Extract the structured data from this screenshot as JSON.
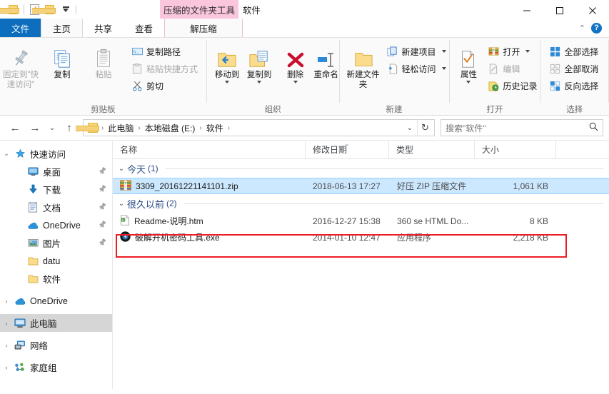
{
  "window": {
    "title": "软件",
    "contextual_tab_header": "压缩的文件夹工具",
    "minimize": "–",
    "maximize": "□",
    "close": "✕",
    "collapse_ribbon": "⌃",
    "help": "?"
  },
  "quick_access_toolbar": {
    "items": [
      {
        "name": "folder-icon",
        "label": ""
      },
      {
        "name": "properties-icon",
        "label": ""
      },
      {
        "name": "new-folder-icon",
        "label": ""
      },
      {
        "name": "customize-dropdown",
        "label": ""
      }
    ]
  },
  "tabs": [
    {
      "id": "file",
      "label": "文件"
    },
    {
      "id": "home",
      "label": "主页"
    },
    {
      "id": "share",
      "label": "共享"
    },
    {
      "id": "view",
      "label": "查看"
    },
    {
      "id": "extract",
      "label": "解压缩"
    }
  ],
  "ribbon": {
    "groups": [
      {
        "label": "剪贴板",
        "big_buttons": [
          {
            "label": "固定到\"快速访问\"",
            "disabled": true,
            "icon": "pin-icon"
          },
          {
            "label": "复制",
            "disabled": false,
            "icon": "copy-icon"
          },
          {
            "label": "粘贴",
            "disabled": true,
            "icon": "paste-icon"
          }
        ],
        "small_buttons": [
          {
            "label": "复制路径",
            "disabled": false,
            "icon": "copy-path-icon"
          },
          {
            "label": "粘贴快捷方式",
            "disabled": true,
            "icon": "paste-shortcut-icon"
          },
          {
            "label": "剪切",
            "disabled": false,
            "icon": "scissors-icon"
          }
        ]
      },
      {
        "label": "组织",
        "buttons": [
          {
            "label": "移动到",
            "icon": "move-to-icon",
            "has_dropdown": true
          },
          {
            "label": "复制到",
            "icon": "copy-to-icon",
            "has_dropdown": true
          },
          {
            "label": "删除",
            "icon": "delete-icon",
            "has_dropdown": true
          },
          {
            "label": "重命名",
            "icon": "rename-icon",
            "has_dropdown": false
          }
        ]
      },
      {
        "label": "新建",
        "big_buttons": [
          {
            "label": "新建文件夹",
            "icon": "new-folder-icon"
          }
        ],
        "small_buttons": [
          {
            "label": "新建项目",
            "icon": "new-item-icon",
            "has_dropdown": true
          },
          {
            "label": "轻松访问",
            "icon": "easy-access-icon",
            "has_dropdown": true
          }
        ]
      },
      {
        "label": "打开",
        "big_buttons": [
          {
            "label": "属性",
            "icon": "properties-icon",
            "has_dropdown": true
          }
        ],
        "small_buttons": [
          {
            "label": "打开",
            "icon": "open-archive-icon",
            "has_dropdown": true,
            "disabled": false
          },
          {
            "label": "编辑",
            "icon": "edit-icon",
            "disabled": true
          },
          {
            "label": "历史记录",
            "icon": "history-icon",
            "disabled": false
          }
        ]
      },
      {
        "label": "选择",
        "small_buttons": [
          {
            "label": "全部选择",
            "icon": "select-all-icon"
          },
          {
            "label": "全部取消",
            "icon": "select-none-icon"
          },
          {
            "label": "反向选择",
            "icon": "invert-selection-icon"
          }
        ]
      }
    ]
  },
  "address_bar": {
    "back": "←",
    "forward": "→",
    "recent": "⌄",
    "up": "↑",
    "breadcrumbs": [
      "此电脑",
      "本地磁盘 (E:)",
      "软件"
    ],
    "separator": "›",
    "dropdown": "⌄",
    "refresh": "↻"
  },
  "search": {
    "placeholder": "搜索\"软件\"",
    "icon": "search-icon"
  },
  "nav_pane": {
    "items": [
      {
        "label": "快速访问",
        "icon": "star-icon",
        "chevron": "⌄",
        "indent": 0,
        "pinned": false,
        "selected": false
      },
      {
        "label": "桌面",
        "icon": "desktop-icon",
        "chevron": "",
        "indent": 1,
        "pinned": true,
        "selected": false
      },
      {
        "label": "下载",
        "icon": "download-icon",
        "chevron": "",
        "indent": 1,
        "pinned": true,
        "selected": false
      },
      {
        "label": "文档",
        "icon": "documents-icon",
        "chevron": "",
        "indent": 1,
        "pinned": true,
        "selected": false
      },
      {
        "label": "OneDrive",
        "icon": "onedrive-icon",
        "chevron": "",
        "indent": 1,
        "pinned": true,
        "selected": false
      },
      {
        "label": "图片",
        "icon": "pictures-icon",
        "chevron": "",
        "indent": 1,
        "pinned": true,
        "selected": false
      },
      {
        "label": "datu",
        "icon": "folder-icon",
        "chevron": "",
        "indent": 1,
        "pinned": false,
        "selected": false
      },
      {
        "label": "软件",
        "icon": "folder-icon",
        "chevron": "",
        "indent": 1,
        "pinned": false,
        "selected": false
      },
      {
        "label": "OneDrive",
        "icon": "onedrive-icon",
        "chevron": "›",
        "indent": 0,
        "pinned": false,
        "selected": false
      },
      {
        "label": "此电脑",
        "icon": "thispc-icon",
        "chevron": "›",
        "indent": 0,
        "pinned": false,
        "selected": true
      },
      {
        "label": "网络",
        "icon": "network-icon",
        "chevron": "›",
        "indent": 0,
        "pinned": false,
        "selected": false
      },
      {
        "label": "家庭组",
        "icon": "homegroup-icon",
        "chevron": "›",
        "indent": 0,
        "pinned": false,
        "selected": false
      }
    ]
  },
  "file_list": {
    "columns": [
      {
        "label": "名称",
        "sorted": false
      },
      {
        "label": "修改日期",
        "sorted": true
      },
      {
        "label": "类型",
        "sorted": false
      },
      {
        "label": "大小",
        "sorted": false
      }
    ],
    "groups": [
      {
        "title": "今天",
        "count": "(1)",
        "chevron": "⌄",
        "rows": [
          {
            "name": "3309_20161221141101.zip",
            "date": "2018-06-13 17:27",
            "type": "好压 ZIP 压缩文件",
            "size": "1,061 KB",
            "icon": "zip-archive-icon",
            "selected": true,
            "highlighted": false
          }
        ]
      },
      {
        "title": "很久以前",
        "count": "(2)",
        "chevron": "⌄",
        "rows": [
          {
            "name": "Readme-说明.htm",
            "date": "2016-12-27 15:38",
            "type": "360 se HTML Do...",
            "size": "8 KB",
            "icon": "html-document-icon",
            "selected": false,
            "highlighted": false
          },
          {
            "name": "破解开机密码工具.exe",
            "date": "2014-01-10 12:47",
            "type": "应用程序",
            "size": "2,218 KB",
            "icon": "application-exe-icon",
            "selected": false,
            "highlighted": true
          }
        ]
      }
    ]
  },
  "colors": {
    "accent_blue": "#0c6ebd",
    "contextual_pink": "#f9c6dc",
    "selection_blue": "#cce8ff",
    "highlight_red": "#ee1c25",
    "group_header_text": "#2b4a86",
    "folder_yellow": "#fbd97a"
  }
}
